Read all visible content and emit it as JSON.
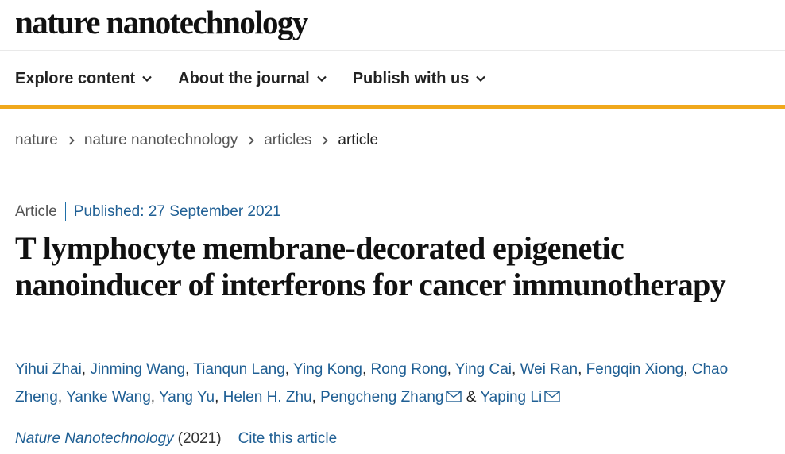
{
  "site": {
    "logo_text": "nature nanotechnology"
  },
  "nav": {
    "items": [
      {
        "label": "Explore content",
        "icon": "chevron-down-icon"
      },
      {
        "label": "About the journal",
        "icon": "chevron-down-icon"
      },
      {
        "label": "Publish with us",
        "icon": "chevron-down-icon"
      }
    ]
  },
  "colors": {
    "accent_rule": "#f0a81c",
    "link": "#1f5f94"
  },
  "breadcrumb": [
    "nature",
    "nature nanotechnology",
    "articles",
    "article"
  ],
  "article": {
    "type": "Article",
    "published": "Published: 27 September 2021",
    "title": "T lymphocyte membrane-decorated epigenetic nanoinducer of interferons for cancer immunotherapy",
    "authors": [
      "Yihui Zhai",
      "Jinming Wang",
      "Tianqun Lang",
      "Ying Kong",
      "Rong Rong",
      "Ying Cai",
      "Wei Ran",
      "Fengqin Xiong",
      "Chao Zheng",
      "Yanke Wang",
      "Yang Yu",
      "Helen H. Zhu",
      "Pengcheng Zhang",
      "Yaping Li"
    ],
    "author_sep": ", ",
    "ampersand": "&",
    "journal": "Nature Nanotechnology",
    "year": "(2021)",
    "cite_label": "Cite this article"
  }
}
